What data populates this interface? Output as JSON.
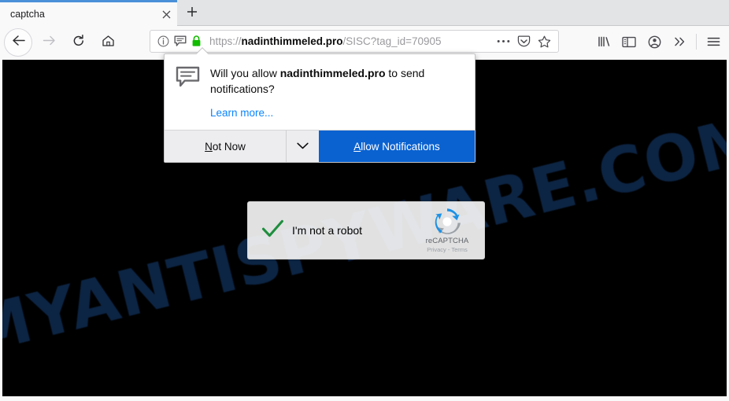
{
  "browser": {
    "tab": {
      "title": "captcha",
      "close_icon": "close-icon",
      "newtab_icon": "plus-icon"
    },
    "nav": {
      "back_icon": "back-arrow-icon",
      "forward_icon": "forward-arrow-icon",
      "reload_icon": "reload-icon",
      "home_icon": "home-icon"
    },
    "urlbar": {
      "info_icon": "info-icon",
      "notification_icon": "notification-bubble-icon",
      "lock_icon": "padlock-icon",
      "scheme": "https://",
      "host": "nadinthimmeled.pro",
      "path": "/SISC?tag_id=70905",
      "full_url": "https://nadinthimmeled.pro/SISC?tag_id=70905",
      "page_actions_icon": "ellipsis-icon",
      "pocket_icon": "pocket-icon",
      "bookmark_icon": "star-icon"
    },
    "toolbar_right": {
      "library_icon": "library-icon",
      "sidebar_icon": "sidebar-icon",
      "account_icon": "account-icon",
      "overflow_icon": "chevron-double-right-icon",
      "menu_icon": "hamburger-menu-icon"
    }
  },
  "doorhanger": {
    "icon": "notification-bubble-icon",
    "question_prefix": "Will you allow ",
    "question_host": "nadinthimmeled.pro",
    "question_suffix": " to send notifications?",
    "learn_more": "Learn more...",
    "not_now_label_accesskey": "N",
    "not_now_label_rest": "ot Now",
    "dropdown_icon": "chevron-down-icon",
    "allow_label_accesskey": "A",
    "allow_label_rest": "llow Notifications",
    "allow_button_color": "#0a62d0"
  },
  "page": {
    "background_color": "#000000",
    "watermark": "MYANTISPYWARE.COM",
    "watermark_color": "#0d2544",
    "recaptcha": {
      "check_icon": "green-checkmark-icon",
      "label": "I'm not a robot",
      "brand_icon": "recaptcha-logo-icon",
      "brand_name": "reCAPTCHA",
      "terms": "Privacy - Terms",
      "checkmark_color": "#1e8e3e"
    }
  }
}
